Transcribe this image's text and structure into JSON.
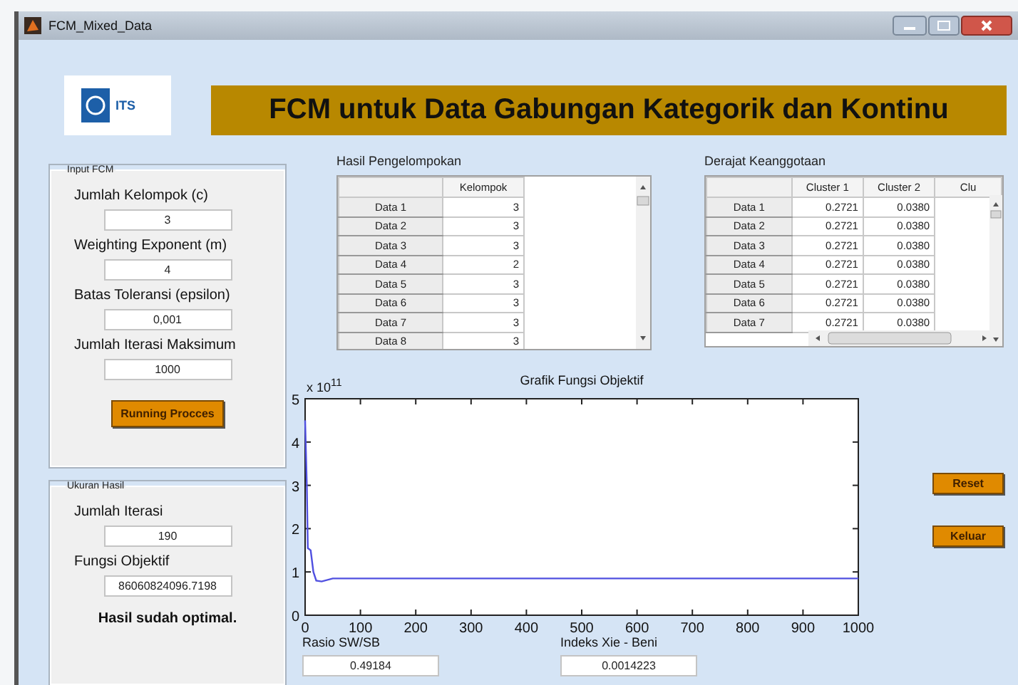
{
  "window": {
    "title": "FCM_Mixed_Data"
  },
  "logo": {
    "text": "ITS"
  },
  "banner_title": "FCM untuk Data Gabungan Kategorik dan Kontinu",
  "input_panel": {
    "title": "Input FCM",
    "fields": [
      {
        "label": "Jumlah Kelompok (c)",
        "value": "3"
      },
      {
        "label": "Weighting Exponent (m)",
        "value": "4"
      },
      {
        "label": "Batas Toleransi (epsilon)",
        "value": "0,001"
      },
      {
        "label": "Jumlah Iterasi Maksimum",
        "value": "1000"
      }
    ],
    "run_button": "Running Procces"
  },
  "result_panel": {
    "title": "Ukuran Hasil",
    "fields": [
      {
        "label": "Jumlah Iterasi",
        "value": "190"
      },
      {
        "label": "Fungsi Objektif",
        "value": "86060824096.7198"
      }
    ],
    "message": "Hasil sudah optimal."
  },
  "clustering_table": {
    "title": "Hasil Pengelompokan",
    "columns": [
      "Kelompok"
    ],
    "rows": [
      {
        "header": "Data 1",
        "cells": [
          "3"
        ]
      },
      {
        "header": "Data 2",
        "cells": [
          "3"
        ]
      },
      {
        "header": "Data 3",
        "cells": [
          "3"
        ]
      },
      {
        "header": "Data 4",
        "cells": [
          "2"
        ]
      },
      {
        "header": "Data 5",
        "cells": [
          "3"
        ]
      },
      {
        "header": "Data 6",
        "cells": [
          "3"
        ]
      },
      {
        "header": "Data 7",
        "cells": [
          "3"
        ]
      },
      {
        "header": "Data 8",
        "cells": [
          "3"
        ]
      }
    ]
  },
  "membership_table": {
    "title": "Derajat Keanggotaan",
    "columns": [
      "Cluster 1",
      "Cluster 2",
      "Clu"
    ],
    "rows": [
      {
        "header": "Data 1",
        "cells": [
          "0.2721",
          "0.0380"
        ]
      },
      {
        "header": "Data 2",
        "cells": [
          "0.2721",
          "0.0380"
        ]
      },
      {
        "header": "Data 3",
        "cells": [
          "0.2721",
          "0.0380"
        ]
      },
      {
        "header": "Data 4",
        "cells": [
          "0.2721",
          "0.0380"
        ]
      },
      {
        "header": "Data 5",
        "cells": [
          "0.2721",
          "0.0380"
        ]
      },
      {
        "header": "Data 6",
        "cells": [
          "0.2721",
          "0.0380"
        ]
      },
      {
        "header": "Data 7",
        "cells": [
          "0.2721",
          "0.0380"
        ]
      }
    ]
  },
  "objective_plot": {
    "chart_data": {
      "type": "line",
      "title": "Grafik Fungsi Objektif",
      "x": [
        0,
        3,
        5,
        10,
        15,
        20,
        30,
        50,
        1000
      ],
      "series": [
        {
          "color": "#5050e0",
          "values": [
            4.5,
            3.0,
            1.55,
            1.5,
            1.0,
            0.8,
            0.78,
            0.85,
            0.85
          ]
        }
      ],
      "xlim": [
        0,
        1000
      ],
      "ylim": [
        0,
        5
      ],
      "xticks": [
        0,
        100,
        200,
        300,
        400,
        500,
        600,
        700,
        800,
        900,
        1000
      ],
      "yticks": [
        0,
        1,
        2,
        3,
        4,
        5
      ],
      "annotations": [
        {
          "text": "x 10$^{11}$"
        }
      ]
    }
  },
  "metrics": [
    {
      "label": "Rasio SW/SB",
      "value": "0.49184"
    },
    {
      "label": "Indeks Xie - Beni",
      "value": "0.0014223"
    }
  ],
  "buttons": [
    "Reset",
    "Keluar"
  ]
}
